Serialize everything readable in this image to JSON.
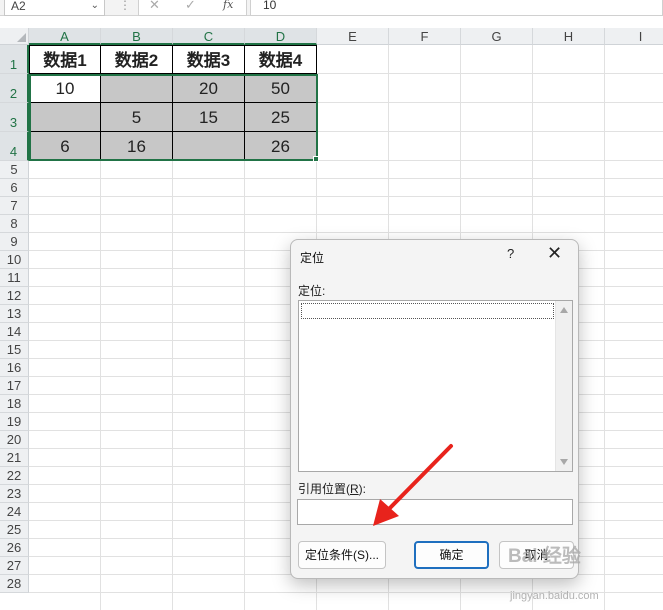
{
  "formula_bar": {
    "name_box": "A2",
    "fx": "fx",
    "cancel_glyph": "✕",
    "enter_glyph": "✓",
    "value": "10"
  },
  "columns": [
    "A",
    "B",
    "C",
    "D",
    "E",
    "F",
    "G",
    "H",
    "I"
  ],
  "rows": [
    "1",
    "2",
    "3",
    "4",
    "5",
    "6",
    "7",
    "8",
    "9",
    "10",
    "11",
    "12",
    "13",
    "14",
    "15",
    "16",
    "17",
    "18",
    "19",
    "20",
    "21",
    "22",
    "23",
    "24",
    "25",
    "26",
    "27",
    "28"
  ],
  "table": {
    "headers": [
      "数据1",
      "数据2",
      "数据3",
      "数据4"
    ],
    "body": [
      [
        "10",
        "",
        "20",
        "50"
      ],
      [
        "",
        "5",
        "15",
        "25"
      ],
      [
        "6",
        "16",
        "",
        "26"
      ]
    ]
  },
  "dialog": {
    "title": "定位",
    "help": "?",
    "close": "✕",
    "goto_label": "定位:",
    "ref_label_prefix": "引用位置(",
    "ref_label_key": "R",
    "ref_label_suffix": "):",
    "ref_value": "",
    "special_button": "定位条件(S)...",
    "ok_button": "确定",
    "cancel_button": "取消"
  },
  "watermark": {
    "text": "Bai 经验",
    "url": "jingyan.baidu.com"
  },
  "colors": {
    "accent": "#217346",
    "gray_cell": "#c7c7c7",
    "arrow": "#e8231c"
  }
}
